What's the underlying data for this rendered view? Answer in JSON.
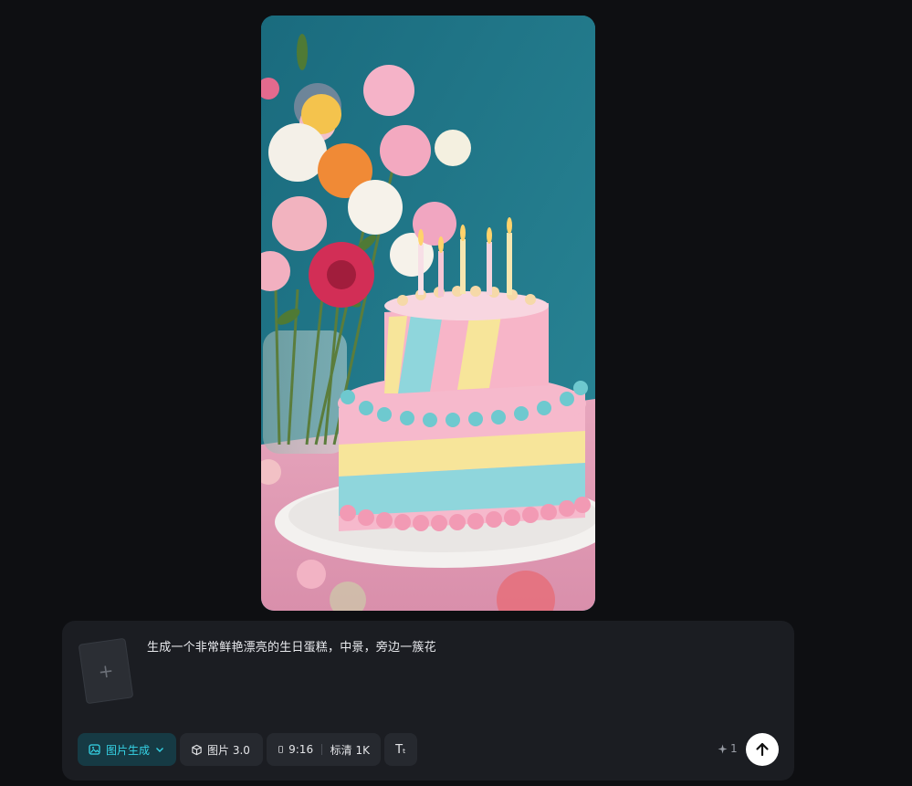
{
  "composer": {
    "prompt": "生成一个非常鲜艳漂亮的生日蛋糕，中景，旁边一簇花",
    "upload_plus": "+",
    "mode_label": "图片生成",
    "model_label": "图片 3.0",
    "ratio_label": "9:16",
    "quality_label": "标清 1K",
    "text_tool_label": "Tₜ",
    "credits": "1"
  },
  "colors": {
    "accent": "#35d3e6",
    "background": "#0e0f12",
    "panel": "#1b1d22"
  },
  "icons": {
    "mode": "image-sparkle-icon",
    "model": "cube-icon",
    "ratio": "phone-portrait-icon",
    "credits": "sparkle-icon",
    "send": "arrow-up-icon"
  }
}
